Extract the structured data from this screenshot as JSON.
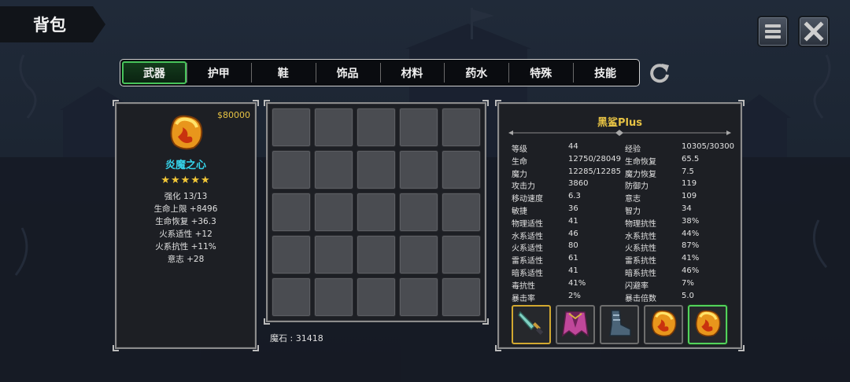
{
  "header": {
    "title": "背包"
  },
  "tabs": [
    {
      "label": "武器",
      "active": true
    },
    {
      "label": "护甲",
      "active": false
    },
    {
      "label": "鞋",
      "active": false
    },
    {
      "label": "饰品",
      "active": false
    },
    {
      "label": "材料",
      "active": false
    },
    {
      "label": "药水",
      "active": false
    },
    {
      "label": "特殊",
      "active": false
    },
    {
      "label": "技能",
      "active": false
    }
  ],
  "item": {
    "price": "$80000",
    "name": "炎魔之心",
    "stars": "★★★★★",
    "icon": "flame-gem-icon",
    "stats": [
      "强化 13/13",
      "生命上限 +8496",
      "生命恢复 +36.3",
      "火系适性 +12",
      "火系抗性 +11%",
      "意志 +28"
    ]
  },
  "inventory": {
    "slot_count": 25,
    "magic_stone": "魔石 : 31418"
  },
  "character": {
    "name": "黑鲨Plus",
    "stats": [
      [
        "等级",
        "44",
        "经验",
        "10305/30300"
      ],
      [
        "生命",
        "12750/28049",
        "生命恢复",
        "65.5"
      ],
      [
        "魔力",
        "12285/12285",
        "魔力恢复",
        "7.5"
      ],
      [
        "攻击力",
        "3860",
        "防御力",
        "119"
      ],
      [
        "移动速度",
        "6.3",
        "意志",
        "109"
      ],
      [
        "敏捷",
        "36",
        "智力",
        "34"
      ],
      [
        "物理适性",
        "41",
        "物理抗性",
        "38%"
      ],
      [
        "水系适性",
        "46",
        "水系抗性",
        "44%"
      ],
      [
        "火系适性",
        "80",
        "火系抗性",
        "87%"
      ],
      [
        "雷系适性",
        "61",
        "雷系抗性",
        "41%"
      ],
      [
        "暗系适性",
        "41",
        "暗系抗性",
        "46%"
      ],
      [
        "毒抗性",
        "41%",
        "闪避率",
        "7%"
      ],
      [
        "暴击率",
        "2%",
        "暴击倍数",
        "5.0"
      ]
    ],
    "equipment": [
      {
        "icon": "dagger-icon",
        "selected": "gold"
      },
      {
        "icon": "cloak-armor-icon",
        "selected": "none"
      },
      {
        "icon": "boots-icon",
        "selected": "none"
      },
      {
        "icon": "flame-gem-icon",
        "selected": "none"
      },
      {
        "icon": "flame-gem-icon",
        "selected": "green"
      }
    ]
  },
  "colors": {
    "accent_gold": "#e6c244",
    "item_name": "#35d4ea",
    "active_tab_border": "#47c35a"
  }
}
